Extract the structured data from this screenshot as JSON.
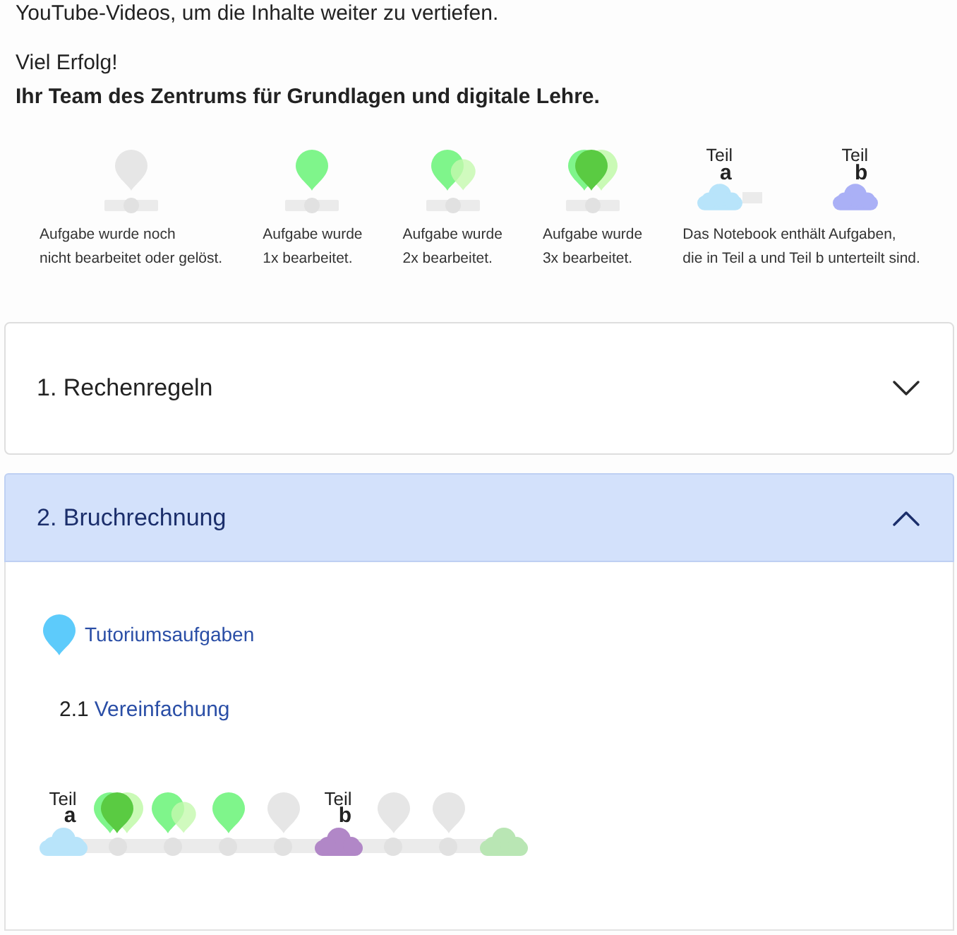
{
  "intro_line": "YouTube-Videos, um die Inhalte weiter zu vertiefen.",
  "greeting": "Viel Erfolg!",
  "signature": "Ihr Team des Zentrums für Grundlagen und digitale Lehre.",
  "legend": [
    {
      "kind": "untouched",
      "caption_lines": [
        "Aufgabe wurde noch",
        "nicht bearbeitet oder gelöst."
      ]
    },
    {
      "kind": "once",
      "caption_lines": [
        "Aufgabe wurde",
        "1x bearbeitet."
      ]
    },
    {
      "kind": "twice",
      "caption_lines": [
        "Aufgabe wurde",
        "2x bearbeitet."
      ]
    },
    {
      "kind": "thrice",
      "caption_lines": [
        "Aufgabe wurde",
        "3x bearbeitet."
      ]
    },
    {
      "kind": "parts",
      "parts": [
        {
          "label": "Teil",
          "letter": "a",
          "color": "#b8e4fa"
        },
        {
          "label": "Teil",
          "letter": "b",
          "color": "#aab0f6"
        }
      ],
      "caption_lines": [
        "Das Notebook enthält Aufgaben,",
        "die in Teil a und Teil b unterteilt sind."
      ]
    }
  ],
  "sections": [
    {
      "title": "1. Rechenregeln",
      "expanded": false
    },
    {
      "title": "2. Bruchrechnung",
      "expanded": true,
      "tutorial": {
        "label": "Tutoriumsaufgaben"
      },
      "subsections": [
        {
          "number": "2.1",
          "title": "Vereinfachung",
          "track": [
            {
              "kind": "part",
              "label": "Teil",
              "letter": "a",
              "color": "#b8e4fa"
            },
            {
              "kind": "thrice"
            },
            {
              "kind": "twice"
            },
            {
              "kind": "once"
            },
            {
              "kind": "untouched"
            },
            {
              "kind": "part",
              "label": "Teil",
              "letter": "b",
              "color": "#b187c7"
            },
            {
              "kind": "untouched"
            },
            {
              "kind": "untouched"
            },
            {
              "kind": "cloud",
              "color": "#b9e6b4"
            }
          ]
        }
      ]
    }
  ]
}
